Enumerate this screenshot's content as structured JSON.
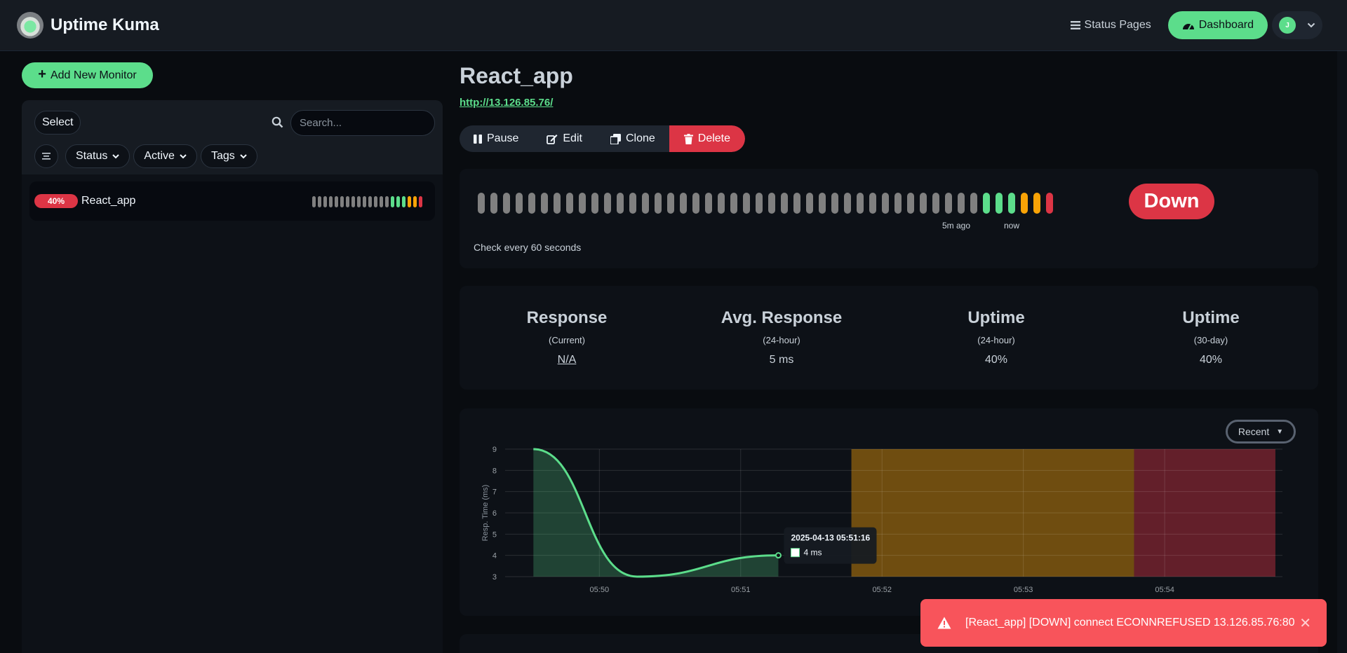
{
  "app": {
    "title": "Uptime Kuma"
  },
  "header": {
    "status_pages": "Status Pages",
    "dashboard": "Dashboard",
    "avatar_initial": "J"
  },
  "sidebar": {
    "add_monitor": "Add New Monitor",
    "select": "Select",
    "search_placeholder": "Search...",
    "filters": [
      "Status",
      "Active",
      "Tags"
    ],
    "monitors": [
      {
        "name": "React_app",
        "uptime": "40%",
        "beats": [
          "g",
          "g",
          "g",
          "g",
          "g",
          "g",
          "g",
          "g",
          "g",
          "g",
          "g",
          "g",
          "g",
          "g",
          "u",
          "u",
          "u",
          "p",
          "p",
          "d"
        ]
      }
    ]
  },
  "monitor": {
    "name": "React_app",
    "url": "http://13.126.85.76/",
    "actions": {
      "pause": "Pause",
      "edit": "Edit",
      "clone": "Clone",
      "delete": "Delete"
    },
    "status": "Down",
    "check_interval": "Check every 60 seconds",
    "beat_labels": {
      "start": "5m ago",
      "end": "now"
    },
    "beats": [
      "g",
      "g",
      "g",
      "g",
      "g",
      "g",
      "g",
      "g",
      "g",
      "g",
      "g",
      "g",
      "g",
      "g",
      "g",
      "g",
      "g",
      "g",
      "g",
      "g",
      "g",
      "g",
      "g",
      "g",
      "g",
      "g",
      "g",
      "g",
      "g",
      "g",
      "g",
      "g",
      "g",
      "g",
      "g",
      "g",
      "g",
      "g",
      "g",
      "g",
      "u",
      "u",
      "u",
      "p",
      "p",
      "d"
    ]
  },
  "colors": {
    "up": "#5cdd8b",
    "down": "#dc3545",
    "pending": "#f8a306",
    "empty": "#808080",
    "accent": "#5cdd8b"
  },
  "stats": [
    {
      "title": "Response",
      "sub": "(Current)",
      "value": "N/A",
      "underline": true
    },
    {
      "title": "Avg. Response",
      "sub": "(24-hour)",
      "value": "5 ms",
      "underline": false
    },
    {
      "title": "Uptime",
      "sub": "(24-hour)",
      "value": "40%",
      "underline": false
    },
    {
      "title": "Uptime",
      "sub": "(30-day)",
      "value": "40%",
      "underline": false
    }
  ],
  "chart": {
    "period_button": "Recent"
  },
  "chart_data": {
    "type": "line",
    "ylabel": "Resp. Time (ms)",
    "ylim": [
      3,
      9
    ],
    "yticks": [
      3,
      4,
      5,
      6,
      7,
      8,
      9
    ],
    "xlim": [
      "05:49:20",
      "05:54:50"
    ],
    "xticks": [
      "05:50",
      "05:51",
      "05:52",
      "05:53",
      "05:54"
    ],
    "series": [
      {
        "x": [
          "05:49:32",
          "05:50:16",
          "05:51:16"
        ],
        "values": [
          9,
          3,
          4
        ]
      }
    ],
    "bands": [
      {
        "from": "05:51:47",
        "to": "05:53:47",
        "status": "pending"
      },
      {
        "from": "05:53:47",
        "to": "05:54:47",
        "status": "down"
      }
    ],
    "grid": true,
    "tooltip": {
      "title": "2025-04-13 05:51:16",
      "value": "4 ms"
    }
  },
  "toast": {
    "message": "[React_app] [DOWN] connect ECONNREFUSED 13.126.85.76:80"
  }
}
